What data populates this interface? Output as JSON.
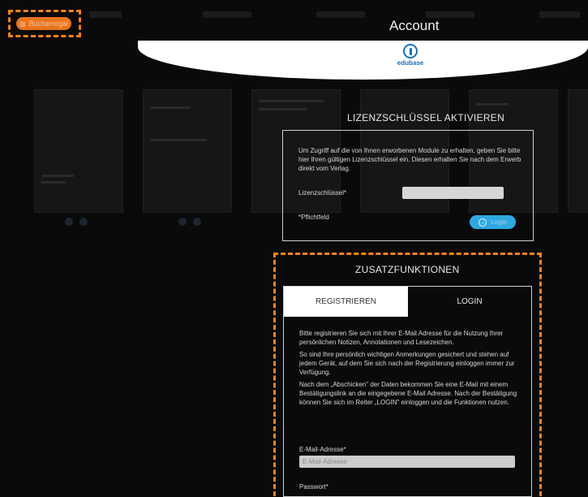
{
  "shelf_button": {
    "label": "Bücherregal",
    "icon": "book-icon"
  },
  "header": {
    "title": "Account",
    "logo_text": "edubase",
    "logo_icon": "edubase-logo-icon"
  },
  "license": {
    "section_title": "LIZENZSCHLÜSSEL AKTIVIEREN",
    "description": "Um Zugriff auf die von Ihnen erworbenen Module zu erhalten, geben Sie bitte hier Ihren gültigen Lizenzschlüssel ein. Diesen erhalten Sie nach dem Erwerb direkt vom Verlag.",
    "key_label": "Lizenzschlüssel*",
    "key_value": "",
    "required_note": "*Pflichtfeld",
    "login_button": "Login",
    "login_icon": "login-arrow-icon"
  },
  "extras": {
    "section_title": "ZUSATZFUNKTIONEN",
    "tabs": [
      {
        "label": "REGISTRIEREN",
        "active": true
      },
      {
        "label": "LOGIN",
        "active": false
      }
    ],
    "register_paragraphs": [
      "Bitte registrieren Sie sich mit Ihrer E-Mail Adresse für die Nutzung Ihrer persönlichen Notizen, Annotationen und Lesezeichen.",
      "So sind Ihre persönlich wichtigen Anmerkungen gesichert und stehen auf jedem Gerät, auf dem Sie sich nach der Registrierung einloggen immer zur Verfügung.",
      "Nach dem „Abschicken\" der Daten bekommen Sie eine E-Mail mit einem Bestätigungslink an die eingegebene E-Mail Adresse. Nach der Bestätigung können Sie sich im Reiter „LOGIN\" einloggen und die Funktionen nutzen."
    ],
    "email_label": "E-Mail-Adresse*",
    "email_placeholder": "E-Mail-Adresse",
    "email_value": "",
    "password_label": "Passwort*"
  },
  "colors": {
    "accent_orange": "#e8731d",
    "highlight_dash": "#f5821f",
    "login_blue": "#2fa8e0",
    "brand_blue": "#1a6fb8",
    "background": "#0a0a0a"
  }
}
